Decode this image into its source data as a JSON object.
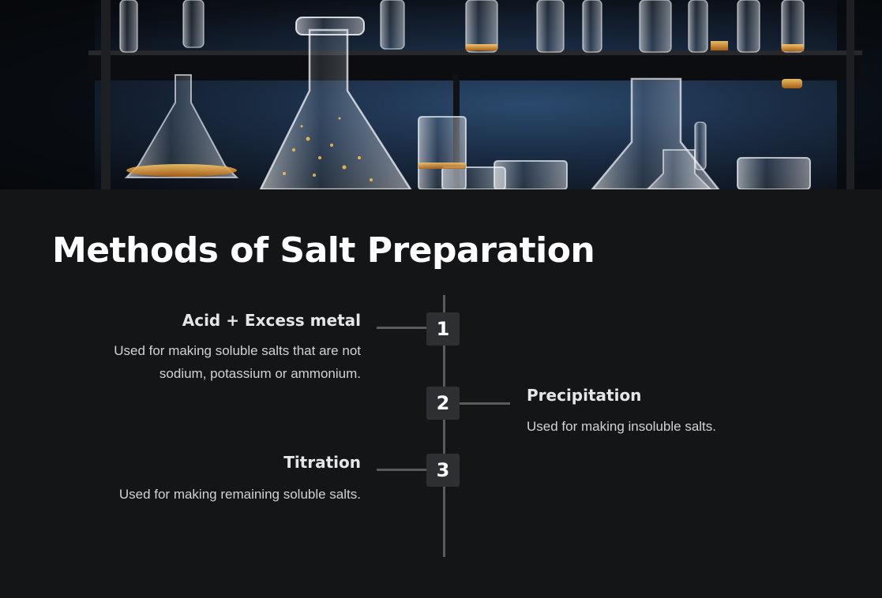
{
  "title": "Methods of Salt Preparation",
  "hero": {
    "image": "laboratory-glassware-photo"
  },
  "steps": [
    {
      "number": "1",
      "title": "Acid + Excess metal",
      "description": "Used for making soluble salts that are not sodium, potassium or ammonium.",
      "side": "left"
    },
    {
      "number": "2",
      "title": "Precipitation",
      "description": "Used for making insoluble salts.",
      "side": "right"
    },
    {
      "number": "3",
      "title": "Titration",
      "description": "Used for making remaining soluble salts.",
      "side": "left"
    }
  ],
  "colors": {
    "background": "#141517",
    "badge": "#2e2f32",
    "line": "#5a5b5e",
    "accent_glow": "#e8a23a"
  }
}
